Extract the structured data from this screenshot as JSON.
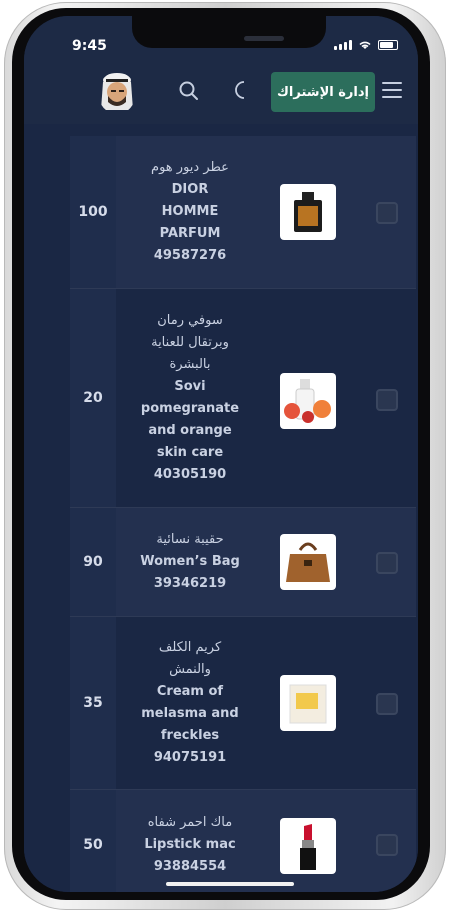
{
  "status_bar": {
    "time": "9:45"
  },
  "header": {
    "subscribe_button": "إدارة الإشتراك",
    "menu_icon": "hamburger-icon",
    "theme_icon": "moon-icon",
    "search_icon": "search-icon"
  },
  "products": [
    {
      "quantity": "100",
      "name_ar": "عطر ديور هوم",
      "name_en_lines": [
        "DIOR",
        "HOMME",
        "PARFUM"
      ],
      "code": "49587276",
      "image_icon": "perfume-bottle"
    },
    {
      "quantity": "20",
      "name_ar_lines": [
        "سوفي رمان",
        "وبرتقال للعناية",
        "بالبشرة"
      ],
      "name_en_lines": [
        "Sovi",
        "pomegranate",
        "and orange",
        "skin care"
      ],
      "code": "40305190",
      "image_icon": "skincare-bottle"
    },
    {
      "quantity": "90",
      "name_ar": "حقيبة نسائية",
      "name_en_lines": [
        "Women’s Bag"
      ],
      "code": "39346219",
      "image_icon": "handbag"
    },
    {
      "quantity": "35",
      "name_ar_lines": [
        "كريم الكلف",
        "والنمش"
      ],
      "name_en_lines": [
        "Cream of",
        "melasma and",
        "freckles"
      ],
      "code": "94075191",
      "image_icon": "cream-jar"
    },
    {
      "quantity": "50",
      "name_ar": "ماك احمر شفاه",
      "name_en_lines": [
        "Lipstick mac"
      ],
      "code": "93884554",
      "image_icon": "lipstick"
    }
  ],
  "colors": {
    "accent": "#2c6e5c",
    "background": "#1a2744",
    "row_alt": "#23304f"
  }
}
